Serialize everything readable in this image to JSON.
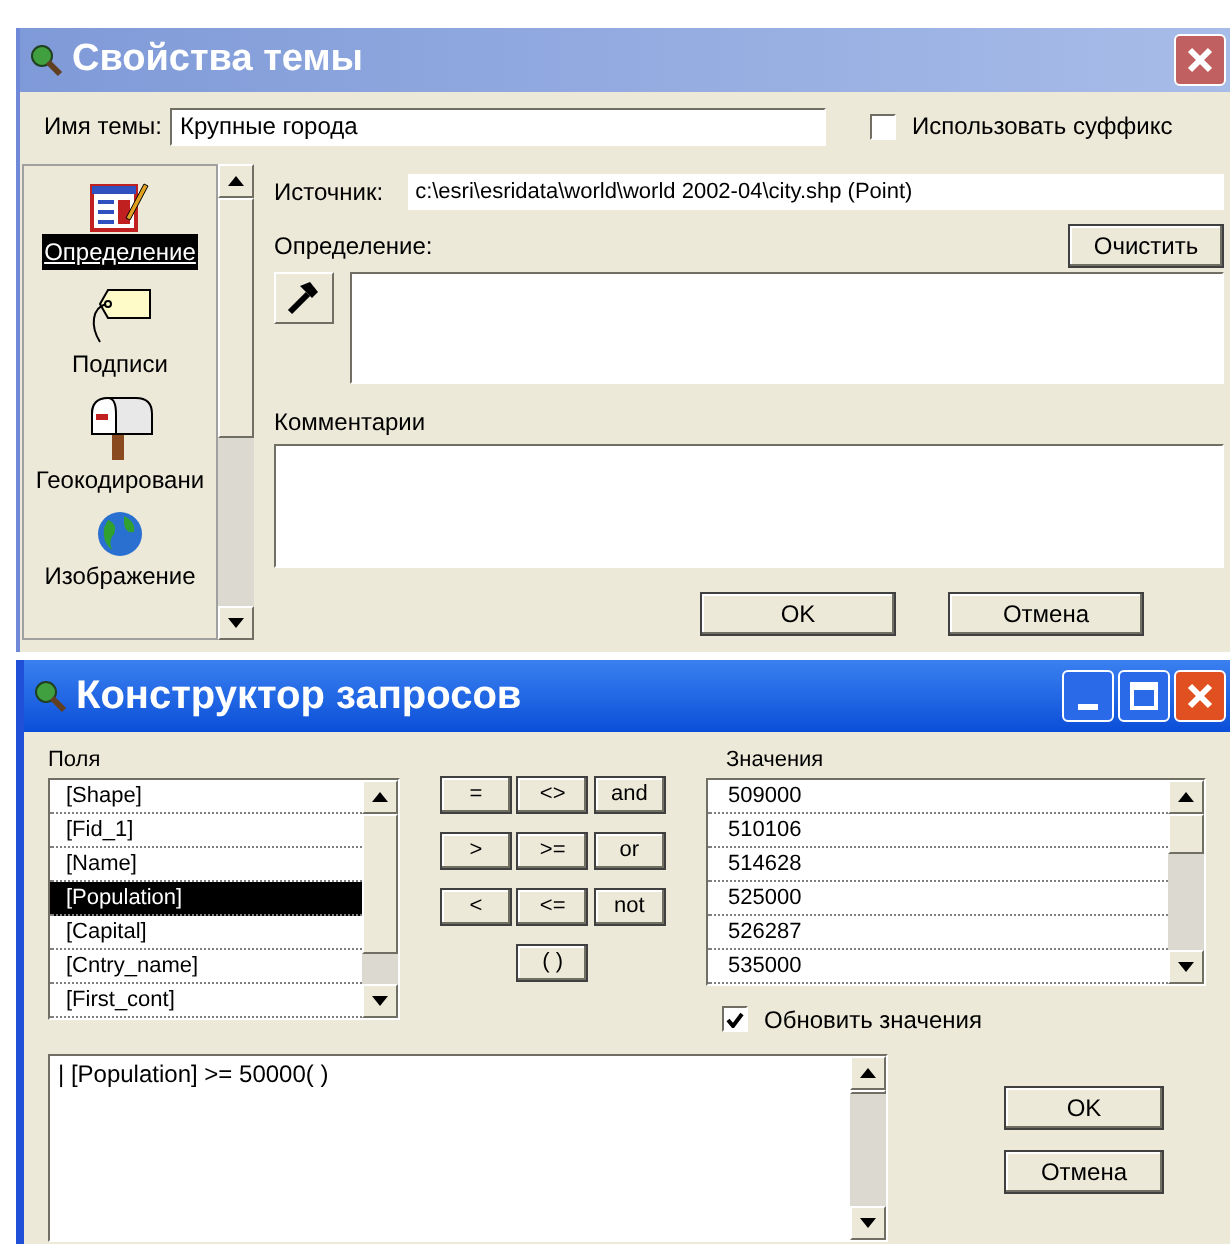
{
  "theme_dialog": {
    "title": "Свойства темы",
    "name_label": "Имя темы:",
    "name_value": "Крупные города",
    "suffix_checkbox": {
      "label": "Использовать суффикс",
      "checked": false
    },
    "sidebar": {
      "items": [
        {
          "label": "Определение",
          "selected": true
        },
        {
          "label": "Подписи",
          "selected": false
        },
        {
          "label": "Геокодировани",
          "selected": false
        },
        {
          "label": "Изображение",
          "selected": false
        }
      ]
    },
    "source_label": "Источник:",
    "source_value": "c:\\esri\\esridata\\world\\world 2002-04\\city.shp (Point)",
    "definition_label": "Определение:",
    "clear_button": "Очистить",
    "comments_label": "Комментарии",
    "buttons": [
      "OK",
      "Отмена"
    ]
  },
  "query_dialog": {
    "title": "Конструктор запросов",
    "fields_label": "Поля",
    "fields": [
      {
        "label": "[Shape]",
        "selected": false
      },
      {
        "label": "[Fid_1]",
        "selected": false
      },
      {
        "label": "[Name]",
        "selected": false
      },
      {
        "label": "[Population]",
        "selected": true
      },
      {
        "label": "[Capital]",
        "selected": false
      },
      {
        "label": "[Cntry_name]",
        "selected": false
      },
      {
        "label": "[First_cont]",
        "selected": false
      }
    ],
    "operators": [
      "=",
      "<>",
      "and",
      ">",
      ">=",
      "or",
      "<",
      "<=",
      "not",
      "( )"
    ],
    "values_label": "Значения",
    "values": [
      "509000",
      "510106",
      "514628",
      "525000",
      "526287",
      "535000"
    ],
    "update_checkbox": {
      "label": "Обновить значения",
      "checked": true
    },
    "query_text": "| [Population] >= 50000( )",
    "buttons": [
      "OK",
      "Отмена"
    ]
  }
}
